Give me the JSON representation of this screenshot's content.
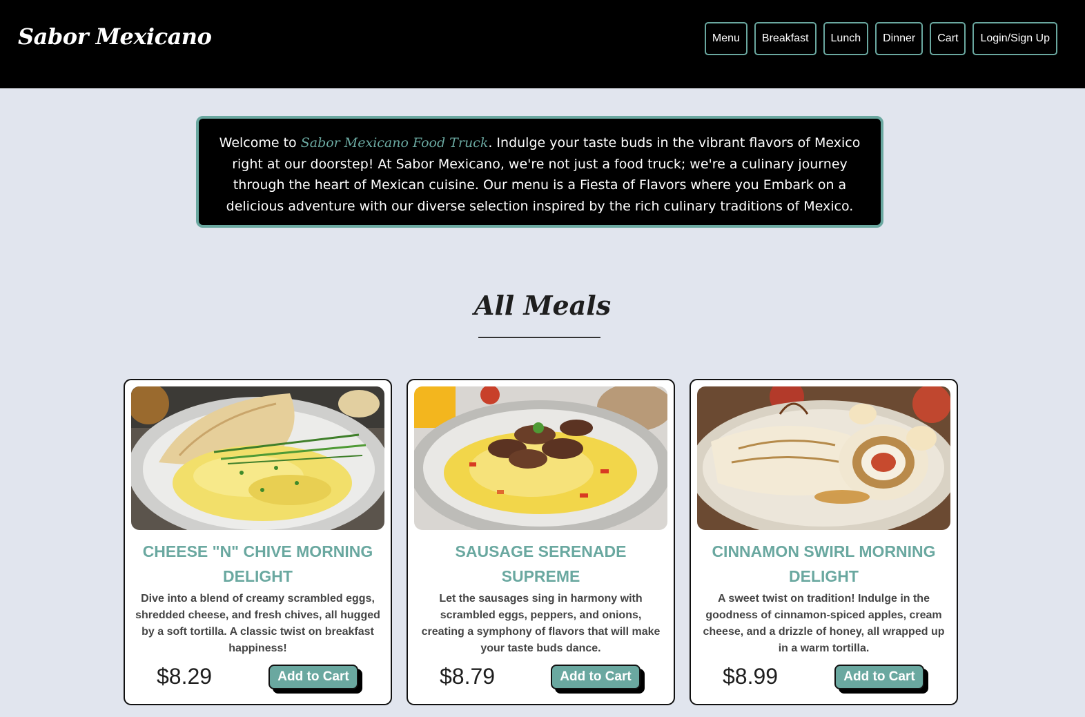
{
  "header": {
    "brand": "Sabor Mexicano",
    "nav": [
      "Menu",
      "Breakfast",
      "Lunch",
      "Dinner",
      "Cart",
      "Login/Sign Up"
    ]
  },
  "welcome": {
    "prefix": "Welcome to ",
    "highlight": "Sabor Mexicano Food Truck",
    "body": ". Indulge your taste buds in the vibrant flavors of Mexico right at our doorstep! At Sabor Mexicano, we're not just a food truck; we're a culinary journey through the heart of Mexican cuisine. Our menu is a Fiesta of Flavors where you Embark on a delicious adventure with our diverse selection inspired by the rich culinary traditions of Mexico."
  },
  "section": {
    "title": "All Meals"
  },
  "meals": [
    {
      "title": "CHEESE \"N\" CHIVE MORNING DELIGHT",
      "description": "Dive into a blend of creamy scrambled eggs, shredded cheese, and fresh chives, all hugged by a soft tortilla. A classic twist on breakfast happiness!",
      "price": "$8.29",
      "button": "Add to Cart",
      "image": "scrambled-eggs-tortilla-photo"
    },
    {
      "title": "SAUSAGE SERENADE SUPREME",
      "description": "Let the sausages sing in harmony with scrambled eggs, peppers, and onions, creating a symphony of flavors that will make your taste buds dance.",
      "price": "$8.79",
      "button": "Add to Cart",
      "image": "sausage-eggs-plate-photo"
    },
    {
      "title": "CINNAMON SWIRL MORNING DELIGHT",
      "description": "A sweet twist on tradition! Indulge in the goodness of cinnamon-spiced apples, cream cheese, and a drizzle of honey, all wrapped up in a warm tortilla.",
      "price": "$8.99",
      "button": "Add to Cart",
      "image": "cinnamon-apple-wrap-photo"
    }
  ],
  "colors": {
    "accent": "#6aa8a0",
    "header_bg": "#000000",
    "page_bg": "#e1e5ee"
  }
}
